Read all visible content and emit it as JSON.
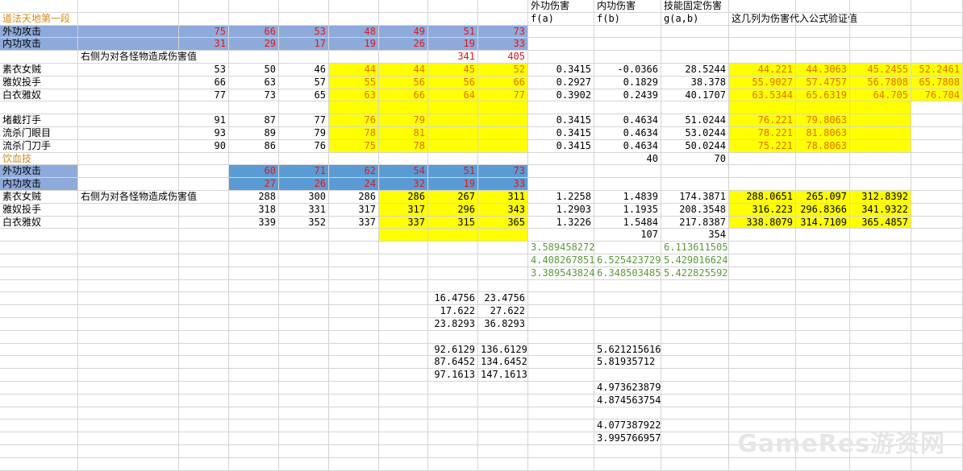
{
  "sheet": {
    "title_top": "道法天地第一段",
    "title_mid": "饮血技",
    "headers": {
      "f_label": "外功伤害",
      "f_formula": "f(a)",
      "g_label": "内功伤害",
      "g_formula": "f(b)",
      "h_label": "技能固定伤害",
      "h_formula": "g(a,b)",
      "verify_label": "这几列为伤害代入公式验证值"
    },
    "section1": {
      "attack_rows": [
        {
          "label": "外功攻击",
          "values": [
            "75",
            "66",
            "53",
            "48",
            "49",
            "51",
            "73"
          ]
        },
        {
          "label": "内功攻击",
          "values": [
            "31",
            "29",
            "17",
            "19",
            "26",
            "19",
            "33"
          ]
        }
      ],
      "note": "右侧为对各怪物造成伤害值",
      "note_values": [
        "341",
        "405"
      ],
      "monsters": [
        {
          "name": "素衣女贼",
          "values": [
            "53",
            "50",
            "46",
            "44",
            "44",
            "45",
            "52"
          ],
          "f": "0.3415",
          "g": "-0.0366",
          "h": "28.5244",
          "verify": [
            "44.221",
            "44.3063",
            "45.2455",
            "52.2461"
          ]
        },
        {
          "name": "雅奴投手",
          "values": [
            "66",
            "63",
            "57",
            "55",
            "56",
            "56",
            "66"
          ],
          "f": "0.2927",
          "g": "0.1829",
          "h": "38.378",
          "verify": [
            "55.9027",
            "57.4757",
            "56.7808",
            "65.7808"
          ]
        },
        {
          "name": "白衣雅奴",
          "values": [
            "77",
            "73",
            "65",
            "63",
            "66",
            "64",
            "77"
          ],
          "f": "0.3902",
          "g": "0.2439",
          "h": "40.1707",
          "verify": [
            "63.5344",
            "65.6319",
            "64.705",
            "76.704"
          ]
        },
        {
          "name": "堵截打手",
          "values": [
            "91",
            "87",
            "77",
            "76",
            "79"
          ],
          "f": "0.3415",
          "g": "0.4634",
          "h": "51.0244",
          "verify": [
            "76.221",
            "79.8063"
          ]
        },
        {
          "name": "流杀门眼目",
          "values": [
            "93",
            "89",
            "79",
            "78",
            "81"
          ],
          "f": "0.3415",
          "g": "0.4634",
          "h": "53.0244",
          "verify": [
            "78.221",
            "81.8063"
          ]
        },
        {
          "name": "流杀门刀手",
          "values": [
            "90",
            "86",
            "76",
            "75",
            "78"
          ],
          "f": "0.3415",
          "g": "0.4634",
          "h": "50.0244",
          "verify": [
            "75.221",
            "78.8063"
          ]
        }
      ],
      "extra_g": "40",
      "extra_h": "70"
    },
    "section2": {
      "attack_rows": [
        {
          "label": "外功攻击",
          "values": [
            "60",
            "71",
            "62",
            "54",
            "51",
            "73"
          ]
        },
        {
          "label": "内功攻击",
          "values": [
            "27",
            "26",
            "24",
            "32",
            "19",
            "33"
          ]
        }
      ],
      "note": "右侧为对各怪物造成伤害值",
      "monsters": [
        {
          "name": "素衣女贼",
          "values": [
            "288",
            "300",
            "286",
            "286",
            "267",
            "311"
          ],
          "f": "1.2258",
          "g": "1.4839",
          "h": "174.3871",
          "verify": [
            "288.0651",
            "265.097",
            "312.8392"
          ]
        },
        {
          "name": "雅奴投手",
          "values": [
            "318",
            "331",
            "317",
            "317",
            "296",
            "343"
          ],
          "f": "1.2903",
          "g": "1.1935",
          "h": "208.3548",
          "verify": [
            "316.223",
            "296.8366",
            "341.9322"
          ]
        },
        {
          "name": "白衣雅奴",
          "values": [
            "339",
            "352",
            "337",
            "337",
            "315",
            "365"
          ],
          "f": "1.3226",
          "g": "1.5484",
          "h": "217.8387",
          "verify": [
            "338.8079",
            "314.7109",
            "365.4857"
          ]
        }
      ],
      "extra_g": "107",
      "extra_h": "354"
    },
    "green_rows": [
      {
        "f": "3.589458272",
        "g": "",
        "h": "6.113611505"
      },
      {
        "f": "4.408267851",
        "g": "6.525423729",
        "h": "5.429016624"
      },
      {
        "f": "3.389543824",
        "g": "6.348503485",
        "h": "5.422825592"
      }
    ],
    "lower_pairs": [
      [
        "16.4756",
        "23.4756"
      ],
      [
        "17.622",
        "27.622"
      ],
      [
        "23.8293",
        "36.8293"
      ],
      [
        "92.6129",
        "136.6129"
      ],
      [
        "87.6452",
        "134.6452"
      ],
      [
        "97.1613",
        "147.1613"
      ]
    ],
    "lower_g": [
      "5.621215616",
      "5.81935712",
      "4.973623879",
      "4.874563754",
      "4.077387922",
      "3.995766957"
    ],
    "watermark": "GameRes游资网",
    "colors": {
      "blue_fill": "#8eaadb",
      "blue_fill_dark": "#5b9bd5",
      "yellow_fill": "#ffff00",
      "red_text": "#e01818",
      "orange_text": "#e07000",
      "green_text": "#5a9a3c",
      "title_text": "#d68a1a",
      "gridline": "#d4d4d4"
    }
  }
}
